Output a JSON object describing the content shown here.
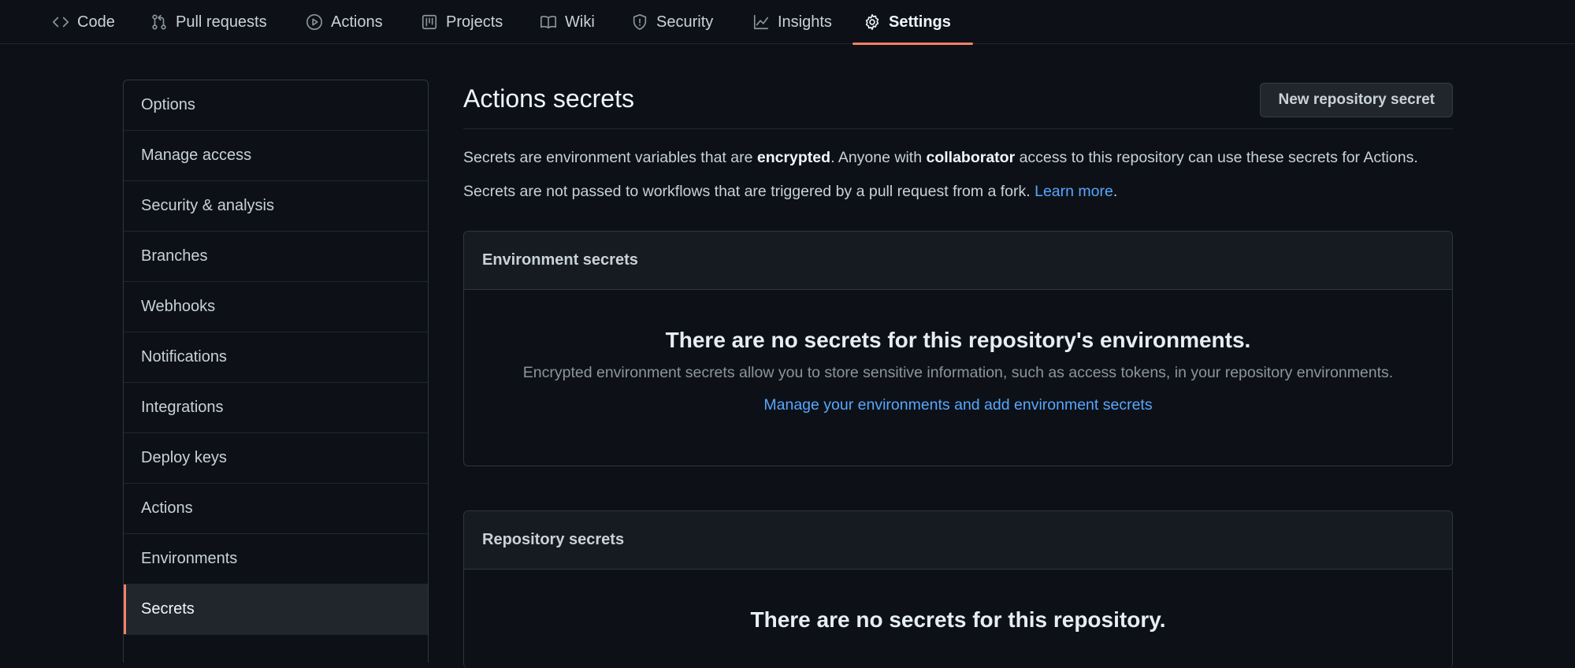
{
  "nav": {
    "tabs": [
      {
        "label": "Code",
        "icon": "code-icon"
      },
      {
        "label": "Pull requests",
        "icon": "git-pull-request-icon"
      },
      {
        "label": "Actions",
        "icon": "play-icon"
      },
      {
        "label": "Projects",
        "icon": "project-icon"
      },
      {
        "label": "Wiki",
        "icon": "book-icon"
      },
      {
        "label": "Security",
        "icon": "shield-icon"
      },
      {
        "label": "Insights",
        "icon": "graph-icon"
      },
      {
        "label": "Settings",
        "icon": "gear-icon"
      }
    ],
    "active": "Settings"
  },
  "sidebar": {
    "items": [
      {
        "label": "Options"
      },
      {
        "label": "Manage access"
      },
      {
        "label": "Security & analysis"
      },
      {
        "label": "Branches"
      },
      {
        "label": "Webhooks"
      },
      {
        "label": "Notifications"
      },
      {
        "label": "Integrations"
      },
      {
        "label": "Deploy keys"
      },
      {
        "label": "Actions"
      },
      {
        "label": "Environments"
      },
      {
        "label": "Secrets"
      }
    ],
    "selected": "Secrets"
  },
  "main": {
    "title": "Actions secrets",
    "new_button": "New repository secret",
    "desc": {
      "p1": "Secrets are environment variables that are ",
      "b1": "encrypted",
      "p2": ". Anyone with ",
      "b2": "collaborator",
      "p3": " access to this repository can use these secrets for Actions."
    },
    "fork_note": {
      "text": "Secrets are not passed to workflows that are triggered by a pull request from a fork. ",
      "link": "Learn more",
      "end": "."
    },
    "env_box": {
      "header": "Environment secrets",
      "empty_title": "There are no secrets for this repository's environments.",
      "empty_desc": "Encrypted environment secrets allow you to store sensitive information, such as access tokens, in your repository environments.",
      "link": "Manage your environments and add environment secrets"
    },
    "repo_box": {
      "header": "Repository secrets",
      "empty_title": "There are no secrets for this repository."
    }
  },
  "colors": {
    "background": "#0d1117",
    "accent": "#f78166",
    "link": "#58a6ff"
  }
}
